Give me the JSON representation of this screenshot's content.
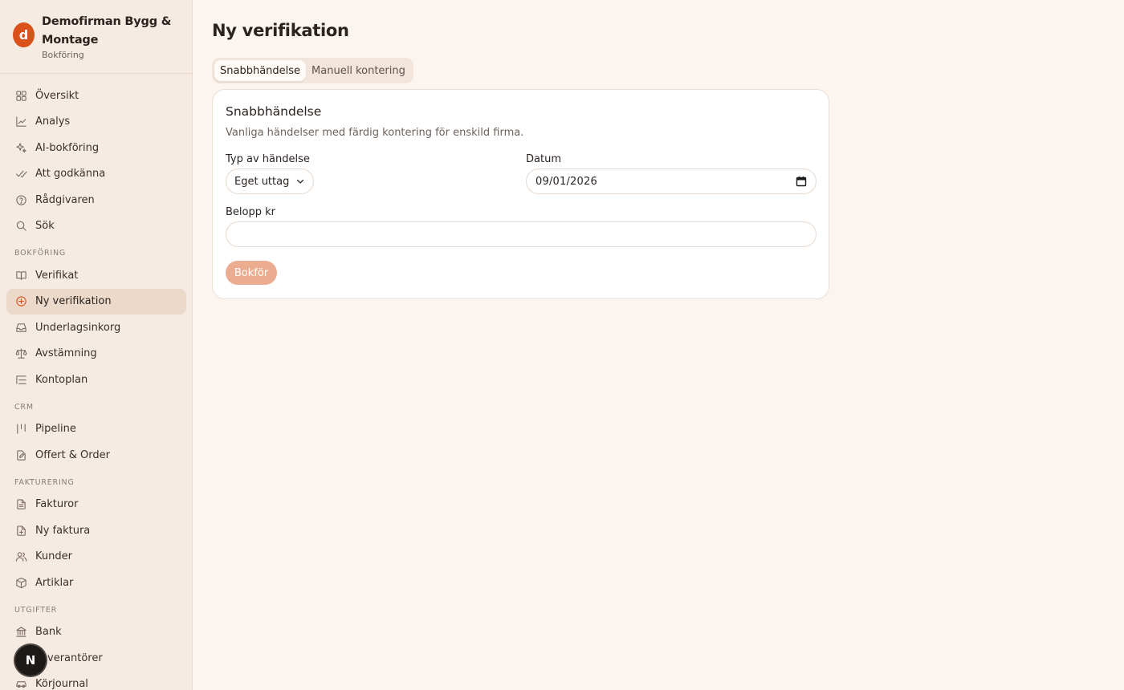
{
  "brand": {
    "logo_letter": "d",
    "name": "Demofirman Bygg & Montage",
    "subtitle": "Bokföring"
  },
  "nav": {
    "top": [
      {
        "label": "Översikt",
        "icon": "grid-icon"
      },
      {
        "label": "Analys",
        "icon": "line-chart-icon"
      },
      {
        "label": "AI-bokföring",
        "icon": "sparkles-icon"
      },
      {
        "label": "Att godkänna",
        "icon": "double-check-icon"
      },
      {
        "label": "Rådgivaren",
        "icon": "help-circle-icon"
      },
      {
        "label": "Sök",
        "icon": "search-icon"
      }
    ],
    "sections": [
      {
        "title": "BOKFÖRING",
        "items": [
          {
            "label": "Verifikat",
            "icon": "book-icon"
          },
          {
            "label": "Ny verifikation",
            "icon": "plus-circle-icon",
            "active": true
          },
          {
            "label": "Underlagsinkorg",
            "icon": "inbox-icon"
          },
          {
            "label": "Avstämning",
            "icon": "scale-icon"
          },
          {
            "label": "Kontoplan",
            "icon": "list-tree-icon"
          }
        ]
      },
      {
        "title": "CRM",
        "items": [
          {
            "label": "Pipeline",
            "icon": "kanban-icon"
          },
          {
            "label": "Offert & Order",
            "icon": "file-edit-icon"
          }
        ]
      },
      {
        "title": "FAKTURERING",
        "items": [
          {
            "label": "Fakturor",
            "icon": "file-text-icon"
          },
          {
            "label": "Ny faktura",
            "icon": "file-plus-icon"
          },
          {
            "label": "Kunder",
            "icon": "users-icon"
          },
          {
            "label": "Artiklar",
            "icon": "package-icon"
          }
        ]
      },
      {
        "title": "UTGIFTER",
        "items": [
          {
            "label": "Bank",
            "icon": "bank-icon"
          },
          {
            "label": "Leverantörer",
            "icon": "truck-icon"
          },
          {
            "label": "Körjournal",
            "icon": "car-icon"
          }
        ]
      }
    ]
  },
  "fab": {
    "label": "N"
  },
  "page": {
    "title": "Ny verifikation",
    "tabs": [
      {
        "label": "Snabbhändelse",
        "active": true
      },
      {
        "label": "Manuell kontering",
        "active": false
      }
    ]
  },
  "card": {
    "title": "Snabbhändelse",
    "description": "Vanliga händelser med färdig kontering för enskild firma.",
    "type_label": "Typ av händelse",
    "type_value": "Eget uttag",
    "date_label": "Datum",
    "date_value": "09/01/2026",
    "amount_label": "Belopp kr",
    "amount_value": "",
    "submit_label": "Bokför"
  },
  "colors": {
    "accent": "#d9521b",
    "background": "#fcf4ee",
    "sidebar": "#f6ebe2",
    "button_disabled": "#ecac90"
  }
}
